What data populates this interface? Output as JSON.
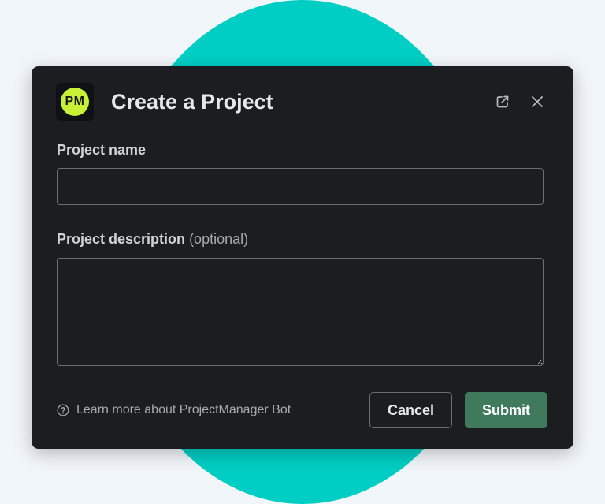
{
  "modal": {
    "app_avatar_text": "PM",
    "title": "Create a Project"
  },
  "fields": {
    "name": {
      "label": "Project name",
      "value": "",
      "placeholder": ""
    },
    "description": {
      "label": "Project description",
      "optional_suffix": "(optional)",
      "value": "",
      "placeholder": ""
    }
  },
  "footer": {
    "help_link": "Learn more about ProjectManager Bot",
    "cancel_label": "Cancel",
    "submit_label": "Submit"
  },
  "icons": {
    "open_external": "external-link-icon",
    "close": "close-icon",
    "help": "question-circle-icon"
  },
  "colors": {
    "background": "#f1f6fa",
    "circle": "#00cec4",
    "modal": "#1b1d21",
    "avatar_accent": "#c8f135",
    "submit": "#3f7a5c"
  }
}
